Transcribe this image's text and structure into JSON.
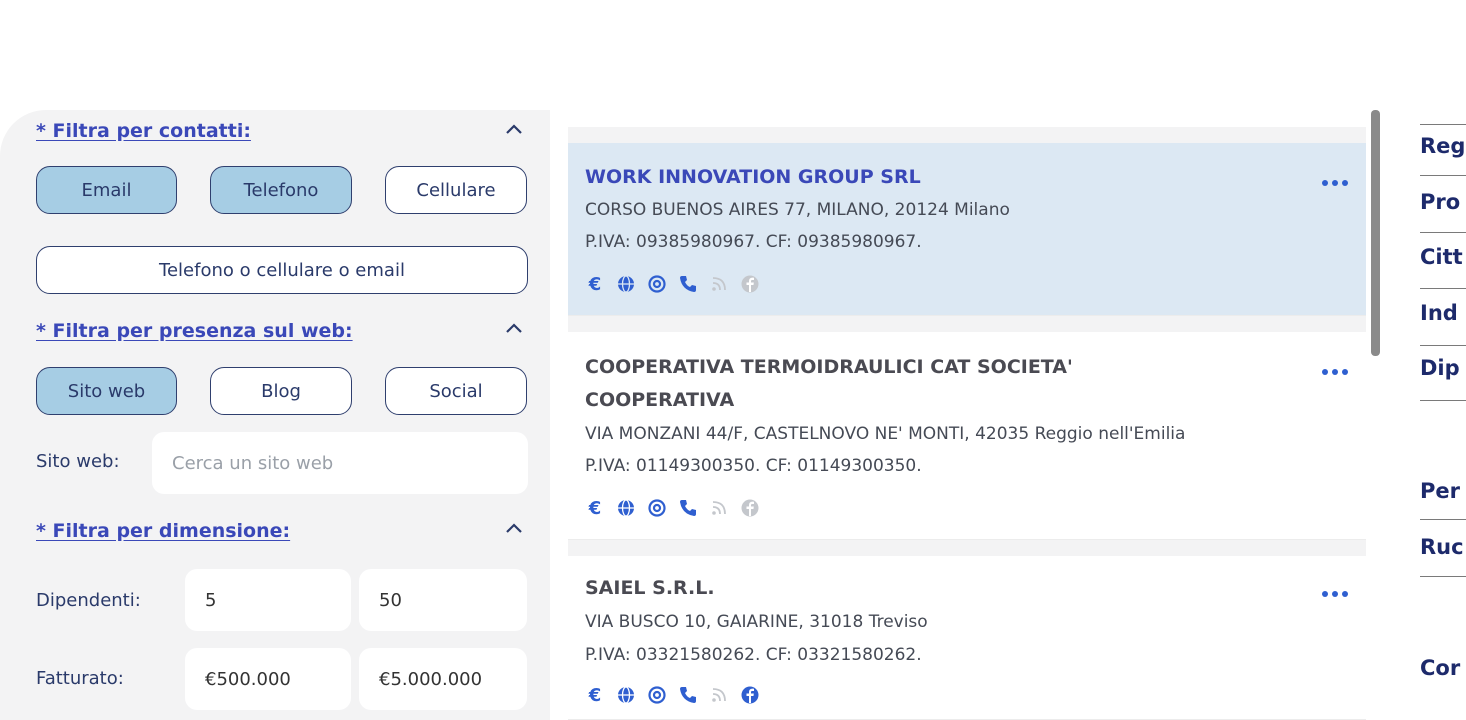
{
  "filters": {
    "contacts": {
      "title": "* Filtra per contatti:",
      "buttons": [
        {
          "label": "Email",
          "active": true
        },
        {
          "label": "Telefono",
          "active": true
        },
        {
          "label": "Cellulare",
          "active": false
        }
      ],
      "any_button": "Telefono o cellulare o email"
    },
    "web": {
      "title": "* Filtra per presenza sul web:",
      "buttons": [
        {
          "label": "Sito web",
          "active": true
        },
        {
          "label": "Blog",
          "active": false
        },
        {
          "label": "Social",
          "active": false
        }
      ],
      "site_label": "Sito web:",
      "site_placeholder": "Cerca un sito web"
    },
    "size": {
      "title": "* Filtra per dimensione:",
      "employees_label": "Dipendenti:",
      "employees_min": "5",
      "employees_max": "50",
      "revenue_label": "Fatturato:",
      "revenue_min": "€500.000",
      "revenue_max": "€5.000.000"
    }
  },
  "results": [
    {
      "name_line1": "WORK INNOVATION GROUP SRL",
      "name_line2": "",
      "address": "CORSO BUENOS AIRES 77, MILANO, 20124 Milano",
      "tax": "P.IVA: 09385980967. CF: 09385980967.",
      "selected": true
    },
    {
      "name_line1": "COOPERATIVA TERMOIDRAULICI CAT SOCIETA'",
      "name_line2": "COOPERATIVA",
      "address": "VIA MONZANI 44/F, CASTELNOVO NE' MONTI, 42035 Reggio nell'Emilia",
      "tax": "P.IVA: 01149300350. CF: 01149300350.",
      "selected": false
    },
    {
      "name_line1": "SAIEL S.R.L.",
      "name_line2": "",
      "address": "VIA BUSCO 10, GAIARINE, 31018 Treviso",
      "tax": "P.IVA: 03321580262. CF: 03321580262.",
      "selected": false
    }
  ],
  "icons": [
    "euro-icon",
    "globe-icon",
    "at-icon",
    "phone-icon",
    "rss-icon",
    "facebook-icon"
  ],
  "right_nav": {
    "items": [
      "Reg",
      "Pro",
      "Citt",
      "Ind",
      "Dip",
      "Per",
      "Ruc",
      "Cor"
    ]
  },
  "colors": {
    "accent": "#3a48b8",
    "active_pill": "#a6cde4",
    "selected_card": "#dce8f3",
    "icon_active": "#2f5fd0",
    "icon_inactive": "#c4c7cc"
  }
}
